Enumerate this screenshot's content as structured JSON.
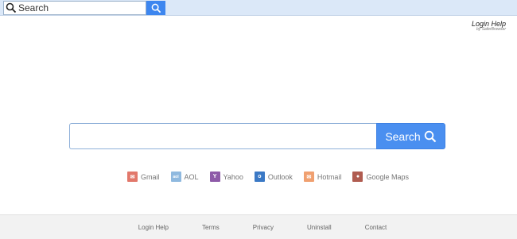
{
  "topbar": {
    "search_placeholder": "Search",
    "search_icon": "search-icon"
  },
  "brand": {
    "name": "Login Help",
    "by": "by SaferBrowser"
  },
  "main_search": {
    "value": "",
    "button_label": "Search",
    "button_icon": "search-icon"
  },
  "quick_links": [
    {
      "label": "Gmail",
      "icon": "gmail-icon",
      "color": "#e2786b"
    },
    {
      "label": "AOL",
      "icon": "aol-icon",
      "color": "#8fb9df"
    },
    {
      "label": "Yahoo",
      "icon": "yahoo-icon",
      "color": "#8e5aa8"
    },
    {
      "label": "Outlook",
      "icon": "outlook-icon",
      "color": "#3b79c5"
    },
    {
      "label": "Hotmail",
      "icon": "hotmail-icon",
      "color": "#f0a070"
    },
    {
      "label": "Google Maps",
      "icon": "google-maps-icon",
      "color": "#b05c50"
    }
  ],
  "footer": {
    "links": [
      "Login Help",
      "Terms",
      "Privacy",
      "Uninstall",
      "Contact"
    ]
  }
}
